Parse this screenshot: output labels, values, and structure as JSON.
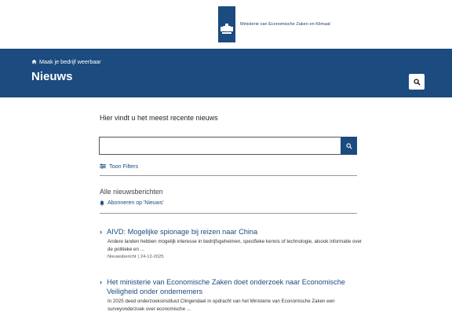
{
  "header": {
    "org_name": "Ministerie van Economische Zaken en Klimaat"
  },
  "banner": {
    "breadcrumb": "Maak je bedrijf weerbaar",
    "title": "Nieuws",
    "color": "#1b4b7f"
  },
  "main": {
    "intro": "Hier vindt u het meest recente nieuws",
    "search": {
      "placeholder": "",
      "value": ""
    },
    "filters_label": "Toon Filters",
    "section_title": "Alle nieuwsberichten",
    "subscribe_label": "Abonneren op 'Nieuws'",
    "news": [
      {
        "title": "AIVD: Mogelijke spionage bij reizen naar China",
        "summary": "Andere landen hebben mogelijk interesse in bedrijfsgeheimen, specifieke kennis of technologie, alsook informatie over de politieke en ...",
        "type": "Nieuwsbericht",
        "separator": "|",
        "date": "24-12-2025"
      },
      {
        "title": "Het ministerie van Economische Zaken doet onderzoek naar Economische Veiligheid onder ondernemers",
        "summary": "In 2025 deed onderzoeksinstituut Clingendael in opdracht van het Ministerie van Economische Zaken een surveyonderzoek over economische ..."
      }
    ]
  }
}
